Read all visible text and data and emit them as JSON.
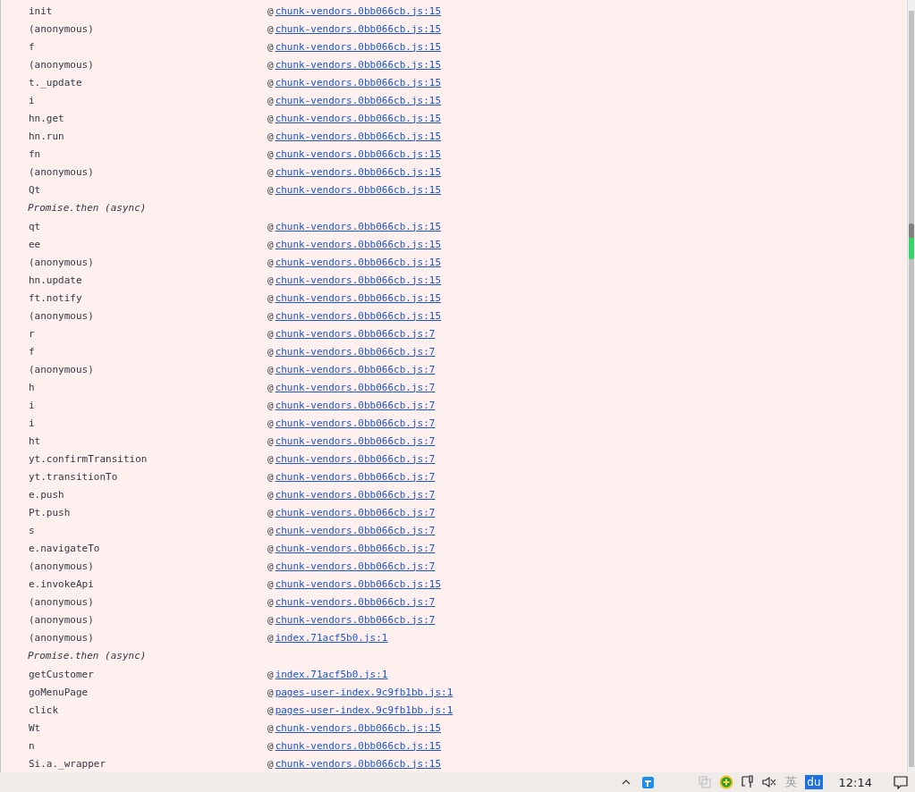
{
  "stack_trace": [
    {
      "kind": "call",
      "function": "init",
      "link": "chunk-vendors.0bb066cb.js:15"
    },
    {
      "kind": "call",
      "function": "(anonymous)",
      "link": "chunk-vendors.0bb066cb.js:15"
    },
    {
      "kind": "call",
      "function": "f",
      "link": "chunk-vendors.0bb066cb.js:15"
    },
    {
      "kind": "call",
      "function": "(anonymous)",
      "link": "chunk-vendors.0bb066cb.js:15"
    },
    {
      "kind": "call",
      "function": "t._update",
      "link": "chunk-vendors.0bb066cb.js:15"
    },
    {
      "kind": "call",
      "function": "i",
      "link": "chunk-vendors.0bb066cb.js:15"
    },
    {
      "kind": "call",
      "function": "hn.get",
      "link": "chunk-vendors.0bb066cb.js:15"
    },
    {
      "kind": "call",
      "function": "hn.run",
      "link": "chunk-vendors.0bb066cb.js:15"
    },
    {
      "kind": "call",
      "function": "fn",
      "link": "chunk-vendors.0bb066cb.js:15"
    },
    {
      "kind": "call",
      "function": "(anonymous)",
      "link": "chunk-vendors.0bb066cb.js:15"
    },
    {
      "kind": "call",
      "function": "Qt",
      "link": "chunk-vendors.0bb066cb.js:15"
    },
    {
      "kind": "async",
      "function": "Promise.then (async)"
    },
    {
      "kind": "call",
      "function": "qt",
      "link": "chunk-vendors.0bb066cb.js:15"
    },
    {
      "kind": "call",
      "function": "ee",
      "link": "chunk-vendors.0bb066cb.js:15"
    },
    {
      "kind": "call",
      "function": "(anonymous)",
      "link": "chunk-vendors.0bb066cb.js:15"
    },
    {
      "kind": "call",
      "function": "hn.update",
      "link": "chunk-vendors.0bb066cb.js:15"
    },
    {
      "kind": "call",
      "function": "ft.notify",
      "link": "chunk-vendors.0bb066cb.js:15"
    },
    {
      "kind": "call",
      "function": "(anonymous)",
      "link": "chunk-vendors.0bb066cb.js:15"
    },
    {
      "kind": "call",
      "function": "r",
      "link": "chunk-vendors.0bb066cb.js:7"
    },
    {
      "kind": "call",
      "function": "f",
      "link": "chunk-vendors.0bb066cb.js:7"
    },
    {
      "kind": "call",
      "function": "(anonymous)",
      "link": "chunk-vendors.0bb066cb.js:7"
    },
    {
      "kind": "call",
      "function": "h",
      "link": "chunk-vendors.0bb066cb.js:7"
    },
    {
      "kind": "call",
      "function": "i",
      "link": "chunk-vendors.0bb066cb.js:7"
    },
    {
      "kind": "call",
      "function": "i",
      "link": "chunk-vendors.0bb066cb.js:7"
    },
    {
      "kind": "call",
      "function": "ht",
      "link": "chunk-vendors.0bb066cb.js:7"
    },
    {
      "kind": "call",
      "function": "yt.confirmTransition",
      "link": "chunk-vendors.0bb066cb.js:7"
    },
    {
      "kind": "call",
      "function": "yt.transitionTo",
      "link": "chunk-vendors.0bb066cb.js:7"
    },
    {
      "kind": "call",
      "function": "e.push",
      "link": "chunk-vendors.0bb066cb.js:7"
    },
    {
      "kind": "call",
      "function": "Pt.push",
      "link": "chunk-vendors.0bb066cb.js:7"
    },
    {
      "kind": "call",
      "function": "s",
      "link": "chunk-vendors.0bb066cb.js:7"
    },
    {
      "kind": "call",
      "function": "e.navigateTo",
      "link": "chunk-vendors.0bb066cb.js:7"
    },
    {
      "kind": "call",
      "function": "(anonymous)",
      "link": "chunk-vendors.0bb066cb.js:7"
    },
    {
      "kind": "call",
      "function": "e.invokeApi",
      "link": "chunk-vendors.0bb066cb.js:15"
    },
    {
      "kind": "call",
      "function": "(anonymous)",
      "link": "chunk-vendors.0bb066cb.js:7"
    },
    {
      "kind": "call",
      "function": "(anonymous)",
      "link": "chunk-vendors.0bb066cb.js:7"
    },
    {
      "kind": "call",
      "function": "(anonymous)",
      "link": "index.71acf5b0.js:1"
    },
    {
      "kind": "async",
      "function": "Promise.then (async)"
    },
    {
      "kind": "call",
      "function": "getCustomer",
      "link": "index.71acf5b0.js:1"
    },
    {
      "kind": "call",
      "function": "goMenuPage",
      "link": "pages-user-index.9c9fb1bb.js:1"
    },
    {
      "kind": "call",
      "function": "click",
      "link": "pages-user-index.9c9fb1bb.js:1"
    },
    {
      "kind": "call",
      "function": "Wt",
      "link": "chunk-vendors.0bb066cb.js:15"
    },
    {
      "kind": "call",
      "function": "n",
      "link": "chunk-vendors.0bb066cb.js:15"
    },
    {
      "kind": "call",
      "function": "Si.a._wrapper",
      "link": "chunk-vendors.0bb066cb.js:15"
    }
  ],
  "link_prefix": "@",
  "taskbar": {
    "ime": "英",
    "baidu": "du",
    "clock": "12:14"
  }
}
